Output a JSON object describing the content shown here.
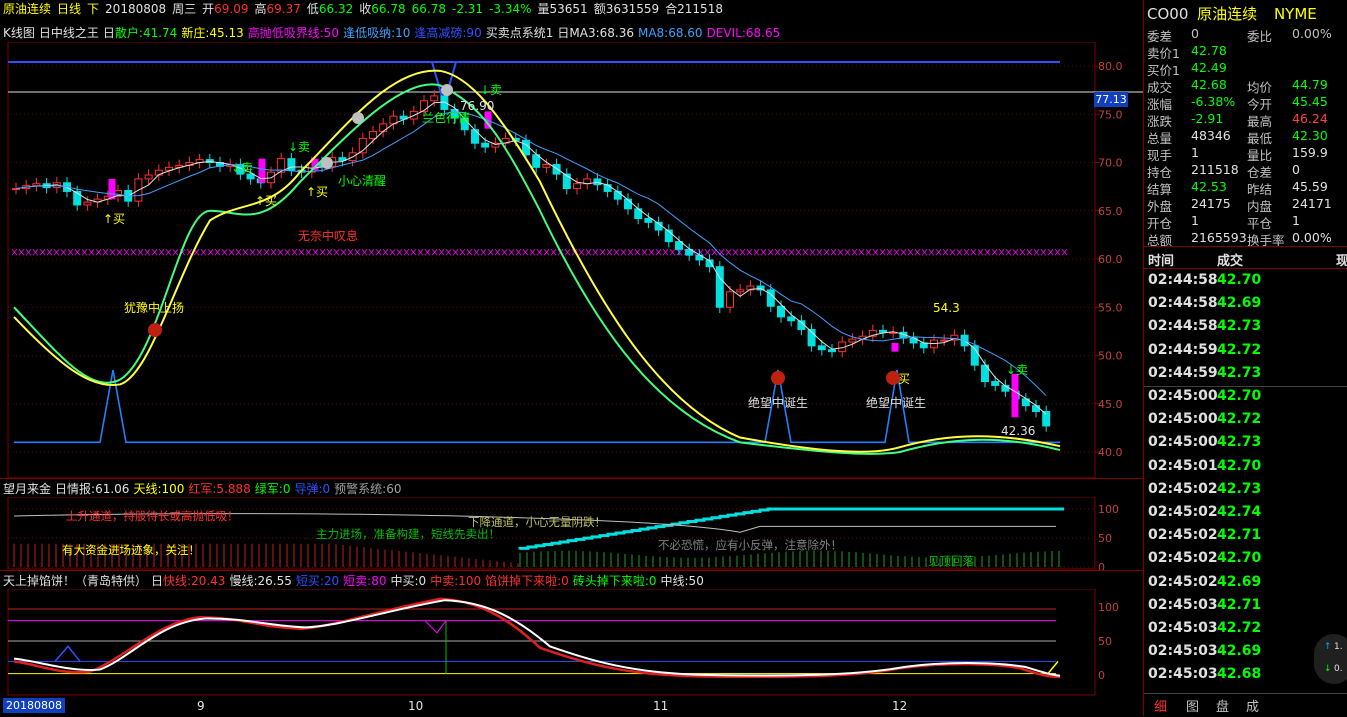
{
  "header": {
    "name": "原油连续",
    "period": "日线",
    "dir": "下",
    "date": "20180808",
    "weekday": "周三",
    "open_label": "开",
    "open": "69.09",
    "high_label": "高",
    "high": "69.37",
    "low_label": "低",
    "low": "66.32",
    "close_label": "收",
    "close": "66.78",
    "last": "66.78",
    "change": "-2.31",
    "change_pct": "-3.34%",
    "volume": "量53651",
    "amount": "额3631559",
    "oi": "合211518"
  },
  "main_indicator": {
    "k_label": "K线图",
    "box1": "日",
    "name": "中线之王",
    "box2": "日",
    "sanhu": "散户:41.74",
    "xinzhuang": "新庄:45.13",
    "gaopao": "高抛低吸界线:50",
    "fengdi": "逢低吸纳:10",
    "fenggao": "逢高减磅:90",
    "maimai": "买卖点系统1",
    "box3": "日",
    "ma3": "MA3:68.36",
    "ma8": "MA8:68.60",
    "devil": "DEVIL:68.65"
  },
  "main_annotations": {
    "buy1": "↑买",
    "sell1": "↓卖",
    "buy2": "↑买",
    "sell2": "↓卖",
    "buy3": "↑买",
    "sell3": "↓卖",
    "sell4": "↓卖",
    "buy4": "↑买",
    "hesitate": "犹豫中上扬",
    "careful": "小心清醒",
    "bubble": "无奈中叹息",
    "top_label": "76.90",
    "despair1": "绝望中诞生",
    "despair2": "绝望中诞生",
    "p543": "54.3",
    "p4236": "42.36",
    "top_text": "兰色行情"
  },
  "price_axis": {
    "ticks": [
      "80.0",
      "75.0",
      "70.0",
      "65.0",
      "60.0",
      "55.0",
      "50.0",
      "45.0",
      "40.0"
    ],
    "current": "77.13"
  },
  "ind2": {
    "name": "望月来金",
    "box": "日",
    "qingbao": "情报:61.06",
    "tianxian": "天线:100",
    "hongjun": "红军:5.888",
    "lvjun": "绿军:0",
    "daoxian": "导弹:0",
    "yujing": "预警系统:60",
    "t1": "上升通道，持股待长或高抛低吸！",
    "t2": "下降通道，小心无量阴跌！",
    "t3": "有大资金进场迹象，关注！",
    "t4": "主力进场，准备构建，短线先卖出！",
    "t5": "不必恐慌，应有小反弹，注意除外！",
    "t6": "见顶回落",
    "ticks": [
      "100",
      "50",
      "0"
    ]
  },
  "ind3": {
    "name": "天上掉馅饼！（青岛特供）",
    "box": "日",
    "kuaixian": "快线:20.43",
    "manxian": "慢线:26.55",
    "duanmai": "短买:20",
    "duanmai2": "短卖:80",
    "zhongmai": "中买:0",
    "zhongmai2": "中卖:100",
    "xianbing": "馅饼掉下来啦:0",
    "zhuantou": "砖头掉下来啦:0",
    "zhongxian": "中线:50",
    "ticks": [
      "100",
      "50",
      "0"
    ]
  },
  "date_axis": {
    "start": "20180808",
    "labels": [
      "9",
      "10",
      "11",
      "12"
    ]
  },
  "quote": {
    "code": "CO00",
    "name": "原油连续",
    "exchange": "NYME",
    "rows": [
      {
        "l": "委差",
        "v": "0",
        "vc": "#c0c0c0",
        "l2": "委比",
        "v2": "0.00%",
        "v2c": "#c0c0c0"
      },
      {
        "l": "卖价1",
        "v": "42.78",
        "vc": "#00ff00",
        "l2": "",
        "v2": "",
        "v2c": "#c0c0c0"
      },
      {
        "l": "买价1",
        "v": "42.49",
        "vc": "#00ff00",
        "l2": "",
        "v2": "",
        "v2c": "#c0c0c0"
      },
      {
        "l": "成交",
        "v": "42.68",
        "vc": "#00ff00",
        "l2": "均价",
        "v2": "44.79",
        "v2c": "#00ff00"
      },
      {
        "l": "涨幅",
        "v": "-6.38%",
        "vc": "#00ff00",
        "l2": "今开",
        "v2": "45.45",
        "v2c": "#00ff00"
      },
      {
        "l": "涨跌",
        "v": "-2.91",
        "vc": "#00ff00",
        "l2": "最高",
        "v2": "46.24",
        "v2c": "#ff4040"
      },
      {
        "l": "总量",
        "v": "48346",
        "vc": "#e0e0e0",
        "l2": "最低",
        "v2": "42.30",
        "v2c": "#00ff00"
      },
      {
        "l": "现手",
        "v": "1",
        "vc": "#e0e0e0",
        "l2": "量比",
        "v2": "159.9",
        "v2c": "#e0e0e0"
      },
      {
        "l": "持仓",
        "v": "211518",
        "vc": "#e0e0e0",
        "l2": "仓差",
        "v2": "0",
        "v2c": "#e0e0e0"
      },
      {
        "l": "结算",
        "v": "42.53",
        "vc": "#00ff00",
        "l2": "昨结",
        "v2": "45.59",
        "v2c": "#e0e0e0"
      },
      {
        "l": "外盘",
        "v": "24175",
        "vc": "#e0e0e0",
        "l2": "内盘",
        "v2": "24171",
        "v2c": "#e0e0e0"
      },
      {
        "l": "开仓",
        "v": "1",
        "vc": "#e0e0e0",
        "l2": "平仓",
        "v2": "1",
        "v2c": "#e0e0e0"
      },
      {
        "l": "总额",
        "v": "2165593",
        "vc": "#e0e0e0",
        "l2": "换手率",
        "v2": "0.00%",
        "v2c": "#e0e0e0"
      }
    ],
    "tick_header": {
      "time": "时间",
      "price": "成交",
      "vol": "现"
    },
    "ticks": [
      {
        "t": "02:44:58",
        "p": "42.70"
      },
      {
        "t": "02:44:58",
        "p": "42.69"
      },
      {
        "t": "02:44:58",
        "p": "42.73"
      },
      {
        "t": "02:44:59",
        "p": "42.72"
      },
      {
        "t": "02:44:59",
        "p": "42.73"
      },
      {
        "t": "02:45:00",
        "p": "42.70"
      },
      {
        "t": "02:45:00",
        "p": "42.72"
      },
      {
        "t": "02:45:00",
        "p": "42.73"
      },
      {
        "t": "02:45:01",
        "p": "42.70"
      },
      {
        "t": "02:45:02",
        "p": "42.73"
      },
      {
        "t": "02:45:02",
        "p": "42.74"
      },
      {
        "t": "02:45:02",
        "p": "42.71"
      },
      {
        "t": "02:45:02",
        "p": "42.70"
      },
      {
        "t": "02:45:02",
        "p": "42.69"
      },
      {
        "t": "02:45:03",
        "p": "42.71"
      },
      {
        "t": "02:45:03",
        "p": "42.72"
      },
      {
        "t": "02:45:03",
        "p": "42.69"
      },
      {
        "t": "02:45:03",
        "p": "42.68"
      }
    ],
    "float_up": "1.",
    "float_down": "0.",
    "tabs": [
      "细",
      "图",
      "盘",
      "成"
    ]
  },
  "colors": {
    "up": "#ff3030",
    "down": "#00e0e0",
    "border": "#800000",
    "yellow": "#ffff00",
    "green": "#00ff00",
    "magenta": "#ff00ff"
  }
}
